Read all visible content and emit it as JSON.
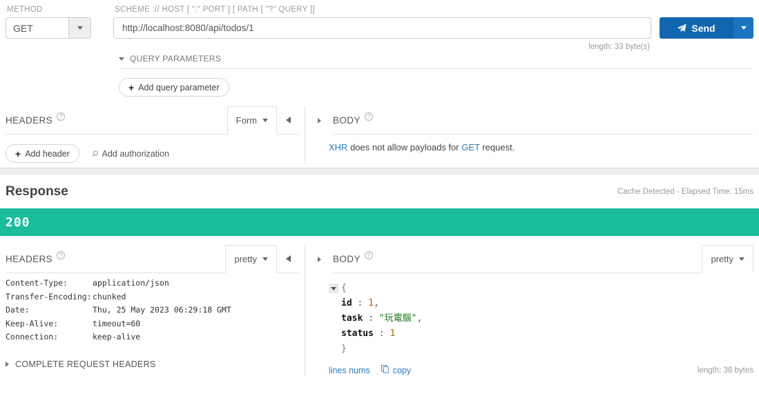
{
  "request": {
    "method_label": "METHOD",
    "method_value": "GET",
    "url_label": "SCHEME :// HOST [ \":\" PORT ] [ PATH [ \"?\" QUERY ]]",
    "url_value": "http://localhost:8080/api/todos/1",
    "send_label": "Send",
    "length_note": "length: 33 byte(s)",
    "query_parameters_label": "QUERY PARAMETERS",
    "add_query_parameter_label": "Add query parameter",
    "headers": {
      "title": "HEADERS",
      "format_value": "Form",
      "add_header_label": "Add header",
      "add_authorization_label": "Add authorization"
    },
    "body": {
      "title": "BODY",
      "note_prefix": "XHR",
      "note_middle": " does not allow payloads for ",
      "note_link": "GET",
      "note_suffix": " request."
    }
  },
  "response": {
    "title": "Response",
    "meta": "Cache Detected - Elapsed Time: 15ms",
    "status_code": "200",
    "status_color": "#1abc9c",
    "headers": {
      "title": "HEADERS",
      "format_value": "pretty",
      "rows": [
        {
          "key": "Content-Type:",
          "value": "application/json"
        },
        {
          "key": "Transfer-Encoding:",
          "value": "chunked"
        },
        {
          "key": "Date:",
          "value": "Thu, 25 May 2023 06:29:18 GMT"
        },
        {
          "key": "Keep-Alive:",
          "value": "timeout=60"
        },
        {
          "key": "Connection:",
          "value": "keep-alive"
        }
      ],
      "complete_request_headers_label": "COMPLETE REQUEST HEADERS"
    },
    "body": {
      "title": "BODY",
      "format_value": "pretty",
      "json": {
        "open_brace": "{",
        "close_brace": "}",
        "entries": [
          {
            "key": "id",
            "sep": " : ",
            "value": "1",
            "type": "num",
            "comma": ","
          },
          {
            "key": "task",
            "sep": " : ",
            "value": "\"玩電腦\"",
            "type": "str",
            "comma": ","
          },
          {
            "key": "status",
            "sep": " : ",
            "value": "1",
            "type": "num",
            "comma": ""
          }
        ]
      },
      "lines_nums_label": "lines nums",
      "copy_label": "copy",
      "length_note": "length: 38 bytes"
    }
  },
  "icons": {
    "help": "?",
    "send": "send-icon",
    "plus": "+",
    "key": "⚲",
    "copy": "copy-icon"
  }
}
